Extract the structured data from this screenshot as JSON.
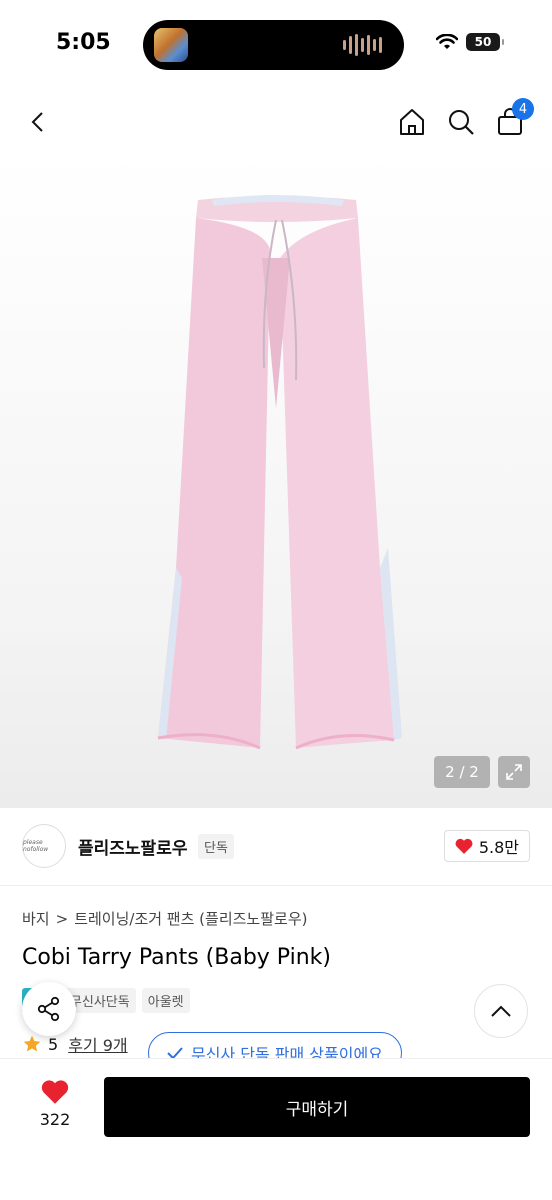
{
  "status_bar": {
    "time": "5:05",
    "battery": "50"
  },
  "nav": {
    "cart_count": "4"
  },
  "gallery": {
    "counter": "2 / 2"
  },
  "brand": {
    "name": "플리즈노팔로우",
    "tag": "단독",
    "logo_text": "please nofollow",
    "likes": "5.8만"
  },
  "breadcrumb": {
    "category": "바지",
    "separator": ">",
    "subcategory": "트레이닝/조거 팬츠 (플리즈노팔로우)"
  },
  "product": {
    "title": "Cobi Tarry Pants (Baby Pink)"
  },
  "chips": [
    {
      "label": "단독"
    },
    {
      "label": "무신사단독"
    },
    {
      "label": "아울렛"
    }
  ],
  "rating": {
    "score": "5",
    "review_label": "후기 9개"
  },
  "exclusive_notice": "무신사 단독 판매 상품이에요",
  "bottom_bar": {
    "like_count": "322",
    "buy_label": "구매하기"
  },
  "colors": {
    "accent_blue": "#2f6fe0",
    "heart_red": "#e8222e",
    "buy_bg": "#000000",
    "chip_accent": "#2bb3c4",
    "pants_pink": "#f2c9db"
  },
  "icons": [
    "back-arrow-icon",
    "home-icon",
    "search-icon",
    "cart-icon",
    "expand-icon",
    "heart-icon",
    "star-icon",
    "check-icon",
    "share-icon",
    "chevron-up-icon",
    "wifi-icon"
  ]
}
